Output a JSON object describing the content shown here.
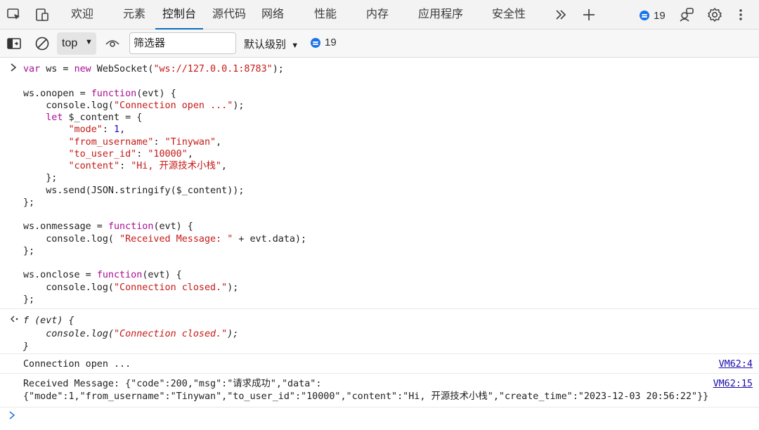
{
  "tabs": [
    {
      "label": "欢迎"
    },
    {
      "label": "元素"
    },
    {
      "label": "控制台"
    },
    {
      "label": "源代码"
    },
    {
      "label": "网络"
    },
    {
      "label": "性能"
    },
    {
      "label": "内存"
    },
    {
      "label": "应用程序"
    },
    {
      "label": "安全性"
    }
  ],
  "active_tab": "控制台",
  "issues_count": "19",
  "toolbar": {
    "context": "top",
    "filter_placeholder": "筛选器",
    "filter_value": "",
    "log_levels": "默认级别",
    "issues_count": "19"
  },
  "console": {
    "input_code": [
      "var ws = new WebSocket(\"ws://127.0.0.1:8783\");",
      "",
      "ws.onopen = function(evt) {",
      "    console.log(\"Connection open ...\");",
      "    let $_content = {",
      "        \"mode\": 1,",
      "        \"from_username\": \"Tinywan\",",
      "        \"to_user_id\": \"10000\",",
      "        \"content\": \"Hi, 开源技术小栈\",",
      "    };",
      "    ws.send(JSON.stringify($_content));",
      "};",
      "",
      "ws.onmessage = function(evt) {",
      "    console.log( \"Received Message: \" + evt.data);",
      "};",
      "",
      "ws.onclose = function(evt) {",
      "    console.log(\"Connection closed.\");",
      "};"
    ],
    "result_lines": [
      "f (evt) {",
      "    console.log(\"Connection closed.\");",
      "}"
    ],
    "logs": [
      {
        "lines": [
          "Connection open ..."
        ],
        "source": "VM62:4"
      },
      {
        "lines": [
          "Received Message: {\"code\":200,\"msg\":\"请求成功\",\"data\":",
          "{\"mode\":1,\"from_username\":\"Tinywan\",\"to_user_id\":\"10000\",\"content\":\"Hi, 开源技术小栈\",\"create_time\":\"2023-12-03 20:56:22\"}}"
        ],
        "source": "VM62:15"
      }
    ]
  },
  "icons": {
    "inspect": "inspect-element-icon",
    "device": "device-toolbar-icon",
    "more_tabs": "chevron-double-right-icon",
    "add_tab": "plus-icon",
    "issues": "message-bubble-icon",
    "connections": "people-icon",
    "settings": "gear-icon",
    "menu": "kebab-menu-icon",
    "sidebar": "sidebar-toggle-icon",
    "clear": "clear-console-icon",
    "live_expression": "eye-icon"
  },
  "colors": {
    "accent": "#0f6cbd",
    "keyword": "#aa0d91",
    "string": "#c41a16",
    "number": "#1c00cf",
    "link": "#1a0dab"
  }
}
